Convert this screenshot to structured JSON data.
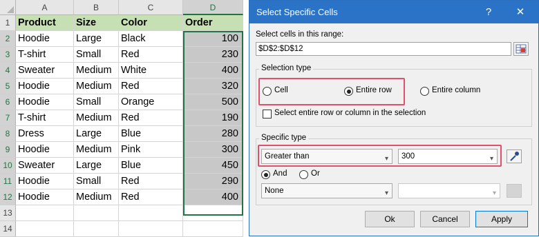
{
  "sheet": {
    "columns": [
      "A",
      "B",
      "C",
      "D"
    ],
    "rows": [
      "1",
      "2",
      "3",
      "4",
      "5",
      "6",
      "7",
      "8",
      "9",
      "10",
      "11",
      "12",
      "13",
      "14"
    ],
    "header": [
      "Product",
      "Size",
      "Color",
      "Order"
    ],
    "data": [
      [
        "Hoodie",
        "Large",
        "Black",
        "100"
      ],
      [
        "T-shirt",
        "Small",
        "Red",
        "230"
      ],
      [
        "Sweater",
        "Medium",
        "White",
        "400"
      ],
      [
        "Hoodie",
        "Medium",
        "Red",
        "320"
      ],
      [
        "Hoodie",
        "Small",
        "Orange",
        "500"
      ],
      [
        "T-shirt",
        "Medium",
        "Red",
        "190"
      ],
      [
        "Dress",
        "Large",
        "Blue",
        "280"
      ],
      [
        "Hoodie",
        "Medium",
        "Pink",
        "300"
      ],
      [
        "Sweater",
        "Large",
        "Blue",
        "450"
      ],
      [
        "Hoodie",
        "Small",
        "Red",
        "290"
      ],
      [
        "Hoodie",
        "Medium",
        "Red",
        "400"
      ]
    ],
    "header_fill": "#c6e0b4",
    "selection_fill": "#c8c8c8",
    "selection_border": "#217346"
  },
  "dialog": {
    "title": "Select Specific Cells",
    "help_label": "?",
    "close_label": "✕",
    "range_label": "Select cells in this range:",
    "range_value": "$D$2:$D$12",
    "selection_type_title": "Selection type",
    "option_cell": "Cell",
    "option_entire_row": "Entire row",
    "option_entire_column": "Entire column",
    "selected_option": "Entire row",
    "checkbox_label": "Select entire row or column in the selection",
    "checkbox_checked": false,
    "specific_type_title": "Specific type",
    "condition1": "Greater than",
    "value1": "300",
    "logic_and": "And",
    "logic_or": "Or",
    "selected_logic": "And",
    "condition2": "None",
    "value2": "",
    "ok_label": "Ok",
    "cancel_label": "Cancel",
    "apply_label": "Apply",
    "titlebar_color": "#2b73c6",
    "highlight_color": "#e0506a"
  }
}
